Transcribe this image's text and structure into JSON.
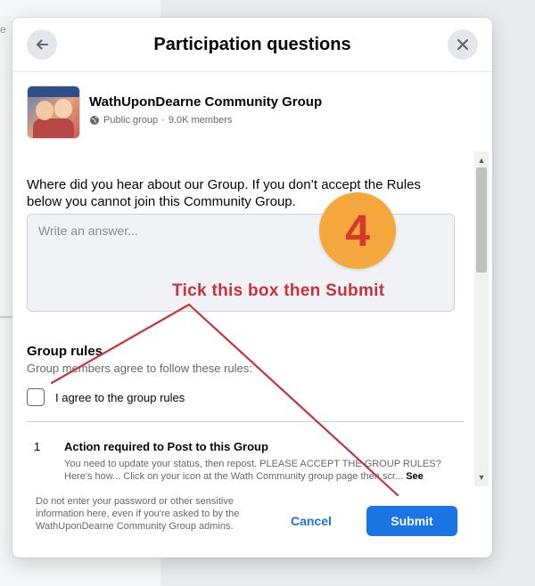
{
  "background": {
    "fragment": "e"
  },
  "dialog": {
    "title": "Participation questions",
    "back_icon": "arrow-left-icon",
    "close_icon": "close-icon"
  },
  "group": {
    "name": "WathUponDearne Community Group",
    "privacy": "Public group",
    "separator": "·",
    "members": "9.0K members",
    "privacy_icon": "globe-icon"
  },
  "question": {
    "text": "Where did you hear about our Group. If you don’t accept the Rules below you cannot join this Community Group.",
    "placeholder": "Write an answer...",
    "value": ""
  },
  "rules": {
    "heading": "Group rules",
    "subtitle": "Group members agree to follow these rules:",
    "agree_label": "I agree to the group rules",
    "checked": false,
    "items": [
      {
        "number": "1",
        "title": "Action required to Post to this Group",
        "description": "You need to update your status, then repost. PLEASE ACCEPT THE GROUP RULES? Here's how... Click on your icon at the Wath Community group page then scr...",
        "see_more": "See"
      }
    ]
  },
  "footer": {
    "note": "Do not enter your password or other sensitive information here, even if you're asked to by the WathUponDearne Community Group admins.",
    "cancel_label": "Cancel",
    "submit_label": "Submit"
  },
  "annotation": {
    "step_number": "4",
    "instruction": "Tick this box then Submit"
  },
  "colors": {
    "accent": "#1b74e4",
    "annotation_red": "#c8323a",
    "badge_orange": "#f4a73c"
  }
}
